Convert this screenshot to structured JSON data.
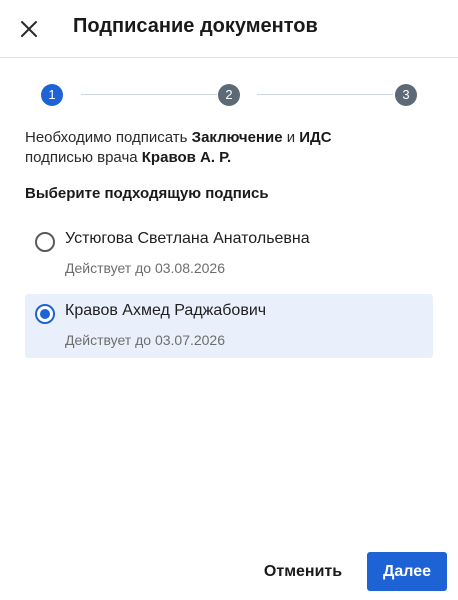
{
  "dialog": {
    "title": "Подписание документов",
    "close_icon": "close-icon"
  },
  "stepper": {
    "steps": [
      "1",
      "2",
      "3"
    ],
    "active_step": 1
  },
  "info": {
    "prefix": "Необходимо подписать ",
    "doc1": "Заключение",
    "and": " и ",
    "doc2": "ИДС",
    "middle": " подписью врача ",
    "doctor": "Кравов А. Р."
  },
  "signature_select": {
    "heading": "Выберите подходящую подпись",
    "options": [
      {
        "name": "Устюгова Светлана Анатольевна",
        "validity": "Действует до 03.08.2026",
        "selected": false
      },
      {
        "name": "Кравов Ахмед Раджабович",
        "validity": "Действует до 03.07.2026",
        "selected": true
      }
    ]
  },
  "footer": {
    "cancel_label": "Отменить",
    "next_label": "Далее"
  },
  "colors": {
    "accent": "#1d63d6",
    "step_inactive": "#5c6a78",
    "selected_bg": "#eaf0fb"
  }
}
